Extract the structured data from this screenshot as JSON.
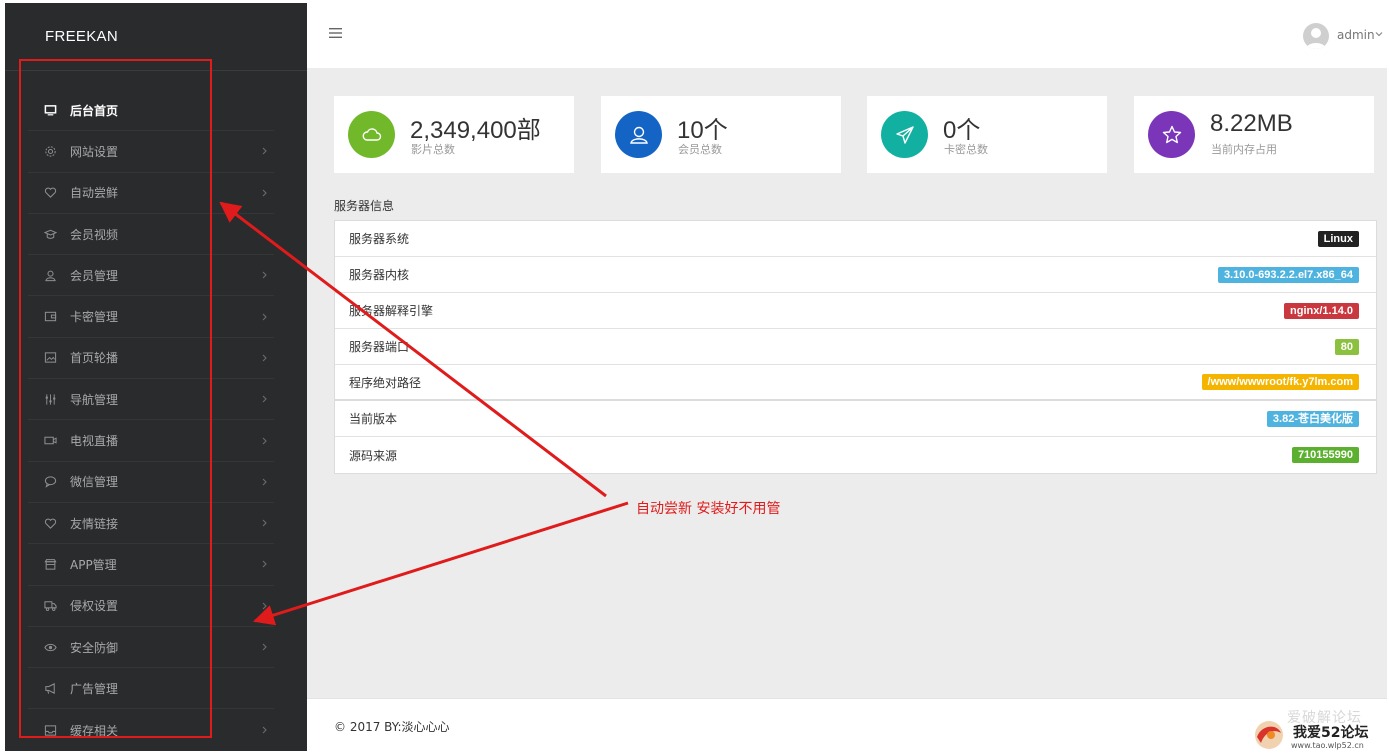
{
  "app": {
    "brand": "FREEKAN"
  },
  "sidebar": {
    "items": [
      {
        "label": "后台首页",
        "icon": "monitor-icon",
        "active": true,
        "chevron": false
      },
      {
        "label": "网站设置",
        "icon": "gear-icon",
        "active": false,
        "chevron": true
      },
      {
        "label": "自动尝鲜",
        "icon": "heart-icon",
        "active": false,
        "chevron": true
      },
      {
        "label": "会员视频",
        "icon": "graduation-cap-icon",
        "active": false,
        "chevron": false
      },
      {
        "label": "会员管理",
        "icon": "user-icon",
        "active": false,
        "chevron": true
      },
      {
        "label": "卡密管理",
        "icon": "wallet-icon",
        "active": false,
        "chevron": true
      },
      {
        "label": "首页轮播",
        "icon": "image-icon",
        "active": false,
        "chevron": true
      },
      {
        "label": "导航管理",
        "icon": "sliders-icon",
        "active": false,
        "chevron": true
      },
      {
        "label": "电视直播",
        "icon": "video-camera-icon",
        "active": false,
        "chevron": true
      },
      {
        "label": "微信管理",
        "icon": "chat-bubble-icon",
        "active": false,
        "chevron": true
      },
      {
        "label": "友情链接",
        "icon": "heart-icon",
        "active": false,
        "chevron": true
      },
      {
        "label": "APP管理",
        "icon": "store-icon",
        "active": false,
        "chevron": true
      },
      {
        "label": "侵权设置",
        "icon": "truck-icon",
        "active": false,
        "chevron": true
      },
      {
        "label": "安全防御",
        "icon": "eye-icon",
        "active": false,
        "chevron": true
      },
      {
        "label": "广告管理",
        "icon": "megaphone-icon",
        "active": false,
        "chevron": false
      },
      {
        "label": "缓存相关",
        "icon": "inbox-icon",
        "active": false,
        "chevron": true
      }
    ]
  },
  "header": {
    "user": "admin"
  },
  "stats": [
    {
      "value": "2,349,400部",
      "label": "影片总数",
      "icon": "cloud-icon",
      "color": "#71b82a"
    },
    {
      "value": "10个",
      "label": "会员总数",
      "icon": "user-icon",
      "color": "#1464c6"
    },
    {
      "value": "0个",
      "label": "卡密总数",
      "icon": "paper-plane-icon",
      "color": "#12b0a0"
    },
    {
      "value": "8.22MB",
      "label": "当前内存占用",
      "icon": "star-icon",
      "color": "#7a35b8"
    }
  ],
  "server": {
    "title": "服务器信息",
    "rows": [
      {
        "key": "服务器系统",
        "value": "Linux",
        "color": "#222222"
      },
      {
        "key": "服务器内核",
        "value": "3.10.0-693.2.2.el7.x86_64",
        "color": "#4fb3e0"
      },
      {
        "key": "服务器解释引擎",
        "value": "nginx/1.14.0",
        "color": "#c9383e"
      },
      {
        "key": "服务器端口",
        "value": "80",
        "color": "#8cc13f"
      },
      {
        "key": "程序绝对路径",
        "value": "/www/wwwroot/fk.y7lm.com",
        "color": "#f4b400"
      },
      {
        "key": "当前版本",
        "value": "3.82-苍白美化版",
        "color": "#4fb3e0"
      },
      {
        "key": "源码来源",
        "value": "710155990",
        "color": "#5cb030"
      }
    ]
  },
  "footer": {
    "copyright": "© 2017 BY:淡心心心"
  },
  "annotation": {
    "text": "自动尝新  安装好不用管",
    "color": "#e01b1b"
  },
  "watermark": {
    "top": "爱破解论坛",
    "main": "我爱52论坛",
    "url": "www.tao.wlp52.cn"
  }
}
